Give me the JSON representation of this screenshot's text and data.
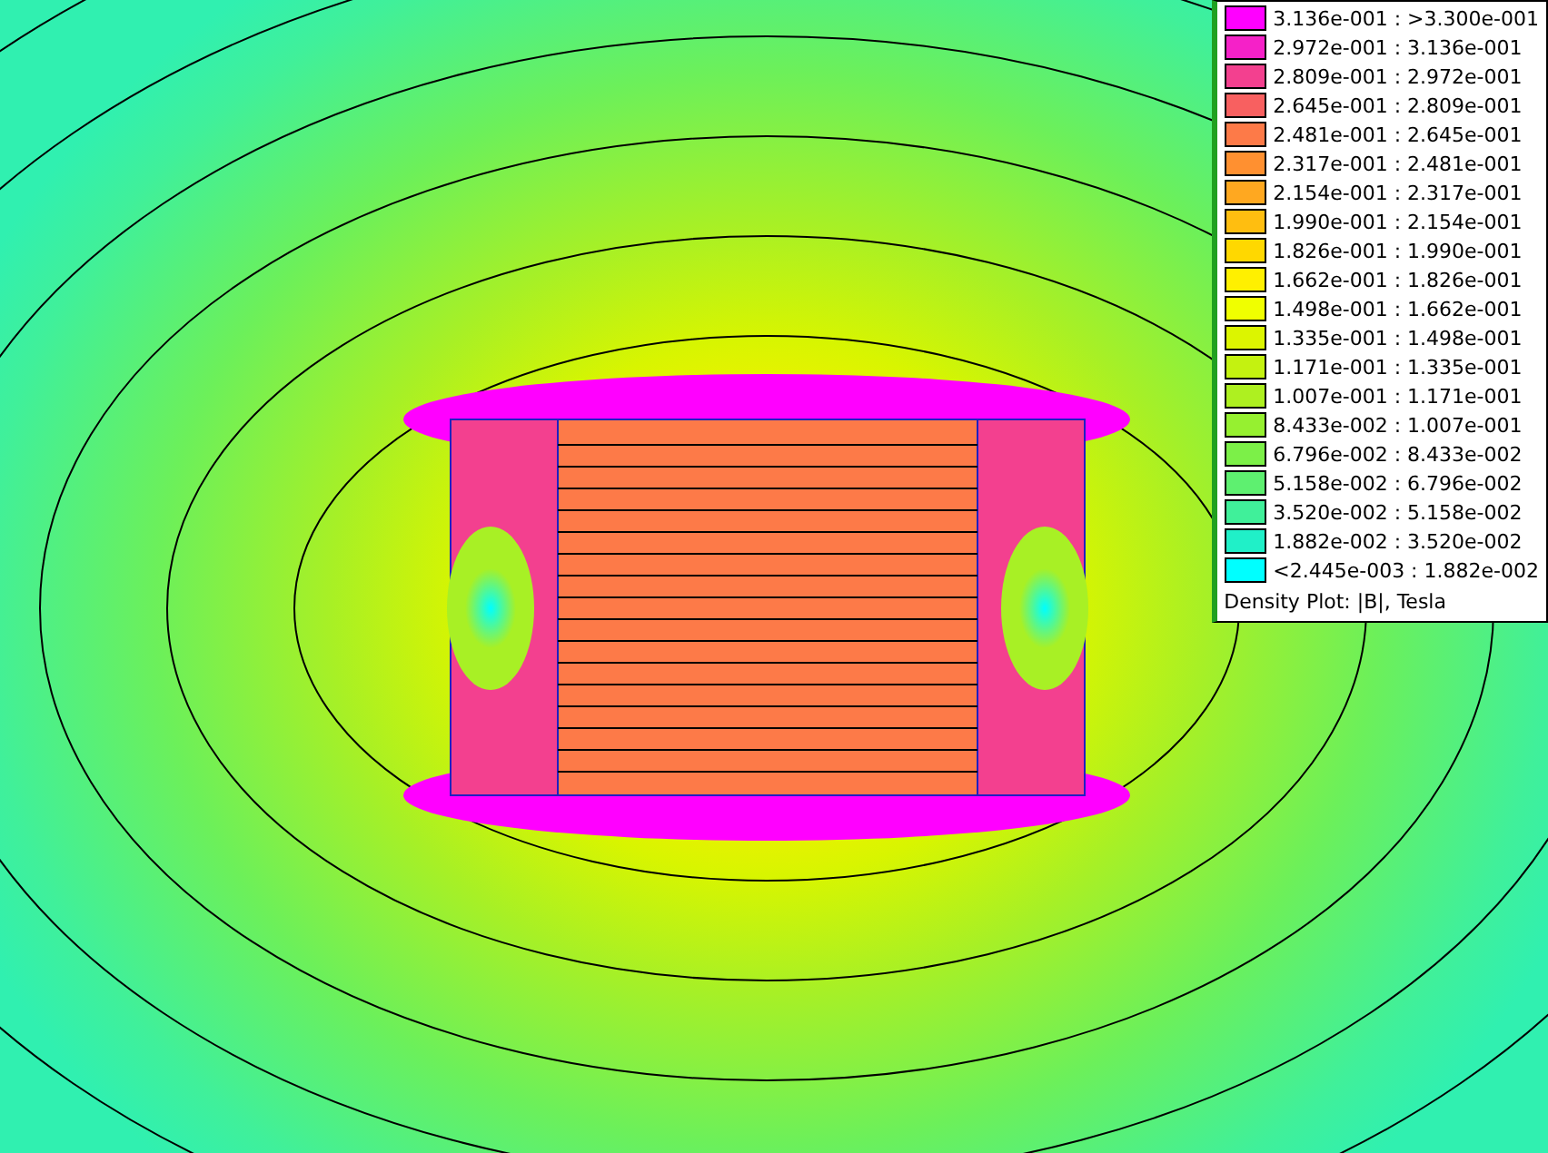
{
  "legend": {
    "rows": [
      {
        "range": "3.136e-001 : >3.300e-001",
        "color": "#ff00ff"
      },
      {
        "range": "2.972e-001 : 3.136e-001",
        "color": "#f521c8"
      },
      {
        "range": "2.809e-001 : 2.972e-001",
        "color": "#f3408f"
      },
      {
        "range": "2.645e-001 : 2.809e-001",
        "color": "#f86060"
      },
      {
        "range": "2.481e-001 : 2.645e-001",
        "color": "#fd7a48"
      },
      {
        "range": "2.317e-001 : 2.481e-001",
        "color": "#ff9030"
      },
      {
        "range": "2.154e-001 : 2.317e-001",
        "color": "#ffa820"
      },
      {
        "range": "1.990e-001 : 2.154e-001",
        "color": "#ffbe10"
      },
      {
        "range": "1.826e-001 : 1.990e-001",
        "color": "#ffd800"
      },
      {
        "range": "1.662e-001 : 1.826e-001",
        "color": "#fff000"
      },
      {
        "range": "1.498e-001 : 1.662e-001",
        "color": "#f0ff00"
      },
      {
        "range": "1.335e-001 : 1.498e-001",
        "color": "#dcf500"
      },
      {
        "range": "1.171e-001 : 1.335e-001",
        "color": "#c4f210"
      },
      {
        "range": "1.007e-001 : 1.171e-001",
        "color": "#aef020"
      },
      {
        "range": "8.433e-002 : 1.007e-001",
        "color": "#96f030"
      },
      {
        "range": "6.796e-002 : 8.433e-002",
        "color": "#7cf048"
      },
      {
        "range": "5.158e-002 : 6.796e-002",
        "color": "#5ef070"
      },
      {
        "range": "3.520e-002 : 5.158e-002",
        "color": "#40f09a"
      },
      {
        "range": "1.882e-002 : 3.520e-002",
        "color": "#20f0c8"
      },
      {
        "range": "<2.445e-003 : 1.882e-002",
        "color": "#00ffff"
      }
    ],
    "caption": "Density Plot: |B|, Tesla"
  }
}
